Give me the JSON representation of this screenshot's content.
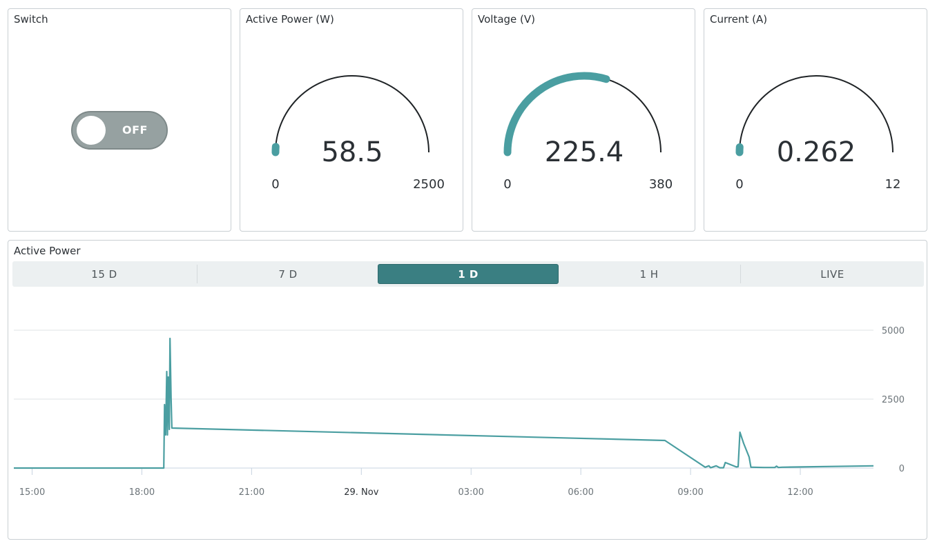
{
  "switch_card": {
    "title": "Switch",
    "state_label": "OFF"
  },
  "gauges": [
    {
      "title": "Active Power (W)",
      "value": 58.5,
      "display": "58.5",
      "min": 0,
      "max": 2500,
      "min_label": "0",
      "max_label": "2500"
    },
    {
      "title": "Voltage (V)",
      "value": 225.4,
      "display": "225.4",
      "min": 0,
      "max": 380,
      "min_label": "0",
      "max_label": "380"
    },
    {
      "title": "Current (A)",
      "value": 0.262,
      "display": "0.262",
      "min": 0,
      "max": 12,
      "min_label": "0",
      "max_label": "12"
    }
  ],
  "chart_panel": {
    "title": "Active Power",
    "tabs": [
      {
        "label": "15 D",
        "active": false
      },
      {
        "label": "7 D",
        "active": false
      },
      {
        "label": "1 D",
        "active": true
      },
      {
        "label": "1 H",
        "active": false
      },
      {
        "label": "LIVE",
        "active": false
      }
    ]
  },
  "colors": {
    "accent": "#4a9ea1",
    "active_tab": "#3a7f82",
    "gridline": "#dfe3e6",
    "text": "#2b3035"
  },
  "chart_data": {
    "type": "line",
    "title": "Active Power",
    "ylim": [
      0,
      5000
    ],
    "yticks": [
      0,
      2500,
      5000
    ],
    "ytick_labels": [
      "0",
      "2500",
      "5000"
    ],
    "xlim": [
      14.5,
      38.0
    ],
    "xticks": [
      15,
      18,
      21,
      24,
      27,
      30,
      33,
      36
    ],
    "xtick_labels": [
      "15:00",
      "18:00",
      "21:00",
      "29. Nov",
      "03:00",
      "06:00",
      "09:00",
      "12:00"
    ],
    "grid": true,
    "series": [
      {
        "x": [
          14.5,
          18.6,
          18.62,
          18.65,
          18.68,
          18.7,
          18.72,
          18.75,
          18.77,
          18.8,
          18.82,
          32.3,
          33.4,
          33.5,
          33.55,
          33.7,
          33.8,
          33.9,
          33.95,
          34.25,
          34.3,
          34.35,
          34.45,
          34.6,
          34.65,
          34.7,
          35.0,
          35.3,
          35.35,
          35.4,
          35.5,
          38.0
        ],
        "y": [
          0,
          0,
          2300,
          1200,
          3500,
          1200,
          3300,
          1400,
          4700,
          2500,
          1450,
          1000,
          30,
          80,
          10,
          80,
          10,
          10,
          200,
          40,
          50,
          1300,
          900,
          400,
          30,
          30,
          20,
          20,
          70,
          20,
          30,
          80
        ]
      }
    ]
  }
}
